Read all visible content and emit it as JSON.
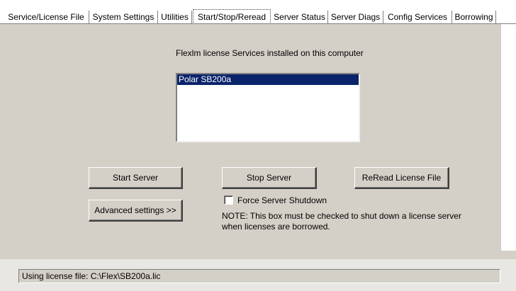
{
  "tabs": [
    {
      "label": "Service/License File",
      "active": false
    },
    {
      "label": "System Settings",
      "active": false
    },
    {
      "label": "Utilities",
      "active": false
    },
    {
      "label": "Start/Stop/Reread",
      "active": true
    },
    {
      "label": "Server Status",
      "active": false
    },
    {
      "label": "Server Diags",
      "active": false
    },
    {
      "label": "Config Services",
      "active": false
    },
    {
      "label": "Borrowing",
      "active": false
    }
  ],
  "main": {
    "services_label": "Flexlm license Services installed on this computer",
    "services": [
      "Polar SB200a"
    ],
    "selected_service": "Polar SB200a",
    "start_button": "Start Server",
    "stop_button": "Stop Server",
    "reread_button": "ReRead License File",
    "advanced_button": "Advanced settings >>",
    "force_shutdown": {
      "label": "Force Server Shutdown",
      "checked": false
    },
    "note": "NOTE:  This box must be checked to shut down a license server when licenses are borrowed."
  },
  "status": {
    "text": "Using license file: C:\\Flex\\SB200a.lic"
  },
  "colors": {
    "selection": "#0a246a",
    "panel": "#d4d0c8"
  }
}
